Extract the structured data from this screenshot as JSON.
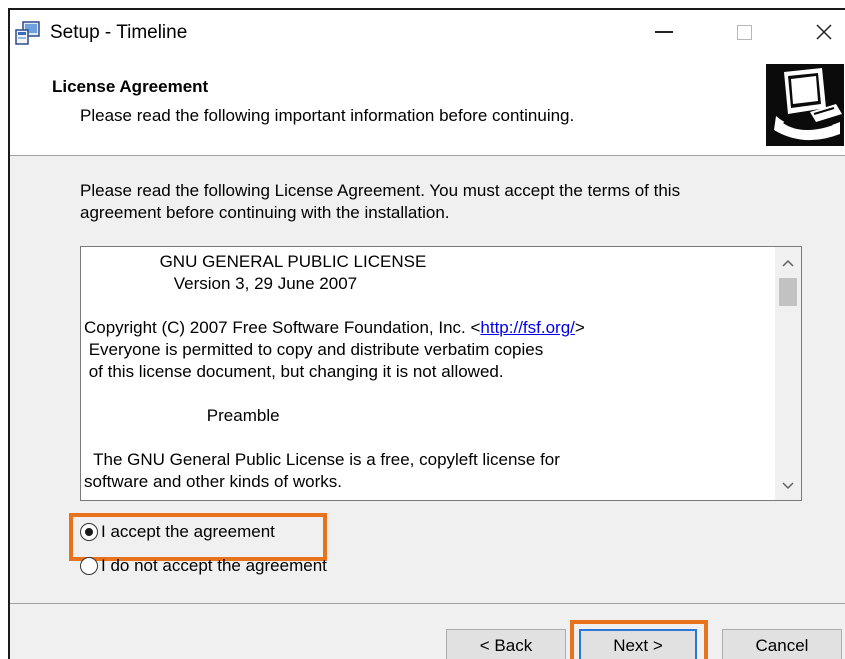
{
  "window": {
    "title": "Setup - Timeline",
    "controls": {
      "minimize_icon": "minimize-icon",
      "maximize_icon": "maximize-icon",
      "close_glyph": "✕"
    }
  },
  "header": {
    "title": "License Agreement",
    "subtitle": "Please read the following important information before continuing.",
    "logo_icon": "setup-computer-icon"
  },
  "intro": {
    "line1": "Please read the following License Agreement. You must accept the terms of this",
    "line2": "agreement before continuing with the installation."
  },
  "license": {
    "line1": "                GNU GENERAL PUBLIC LICENSE",
    "line2": "                   Version 3, 29 June 2007",
    "line3_prefix": "Copyright (C) 2007 Free Software Foundation, Inc. <",
    "line3_link": "http://fsf.org/",
    "line3_suffix": ">",
    "line4": " Everyone is permitted to copy and distribute verbatim copies",
    "line5": " of this license document, but changing it is not allowed.",
    "line6": "                          Preamble",
    "line7": "  The GNU General Public License is a free, copyleft license for",
    "line8": "software and other kinds of works.",
    "scroll_up_glyph": "^",
    "scroll_down_glyph": "v"
  },
  "options": {
    "accept_label": "I accept the agreement",
    "decline_label": "I do not accept the agreement",
    "selected": "accept"
  },
  "buttons": {
    "back": "< Back",
    "next": "Next >",
    "cancel": "Cancel"
  },
  "colors": {
    "highlight": "#e8731c",
    "focus": "#2b78d6"
  }
}
